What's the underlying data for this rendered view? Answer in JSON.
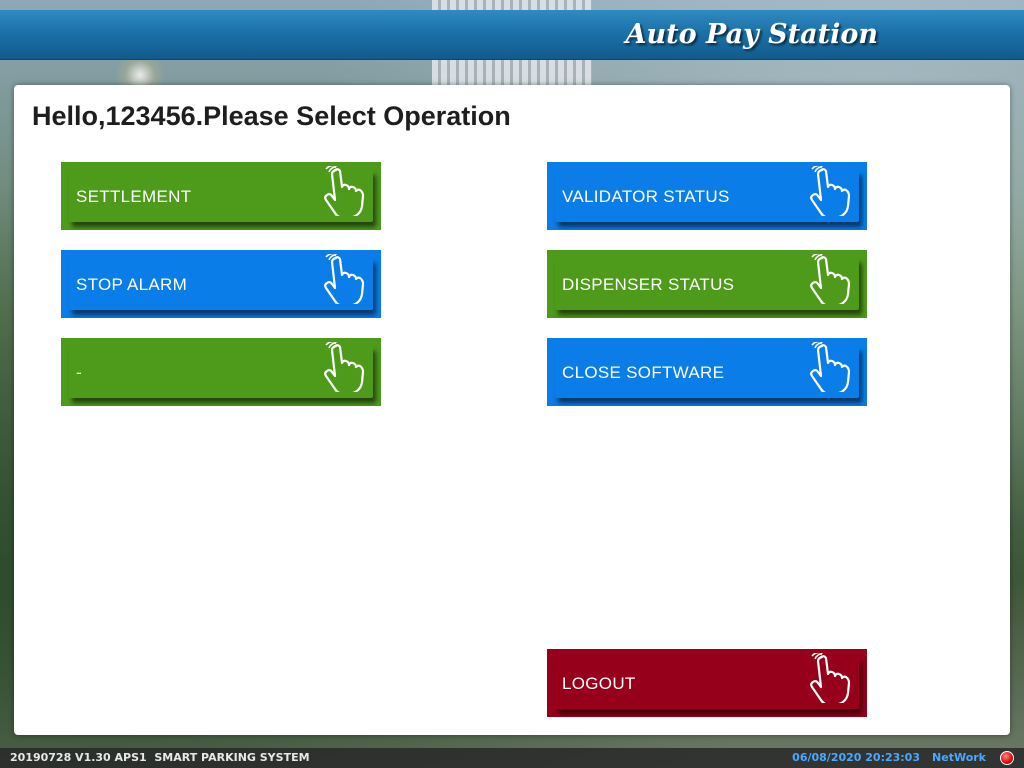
{
  "header": {
    "title": "Auto Pay Station"
  },
  "panel": {
    "greeting": "Hello,123456.Please Select Operation"
  },
  "buttons": {
    "settlement": {
      "label": "SETTLEMENT",
      "color": "#4e9a1a"
    },
    "stop_alarm": {
      "label": "STOP ALARM",
      "color": "#0a7de8"
    },
    "blank": {
      "label": "-",
      "color": "#4e9a1a"
    },
    "validator_status": {
      "label": "VALIDATOR STATUS",
      "color": "#0a7de8"
    },
    "dispenser_status": {
      "label": "DISPENSER STATUS",
      "color": "#4e9a1a"
    },
    "close_software": {
      "label": "CLOSE SOFTWARE",
      "color": "#0a7de8"
    },
    "logout": {
      "label": "LOGOUT",
      "color": "#97001a"
    }
  },
  "button_icon": "hand-pointer-icon",
  "status_bar": {
    "version_info": "20190728 V1.30 APS1  SMART PARKING SYSTEM",
    "datetime": "06/08/2020 20:23:03",
    "network_label": "NetWork",
    "network_indicator_color": "#e01010",
    "status_text_color": "#4aa8ff"
  }
}
